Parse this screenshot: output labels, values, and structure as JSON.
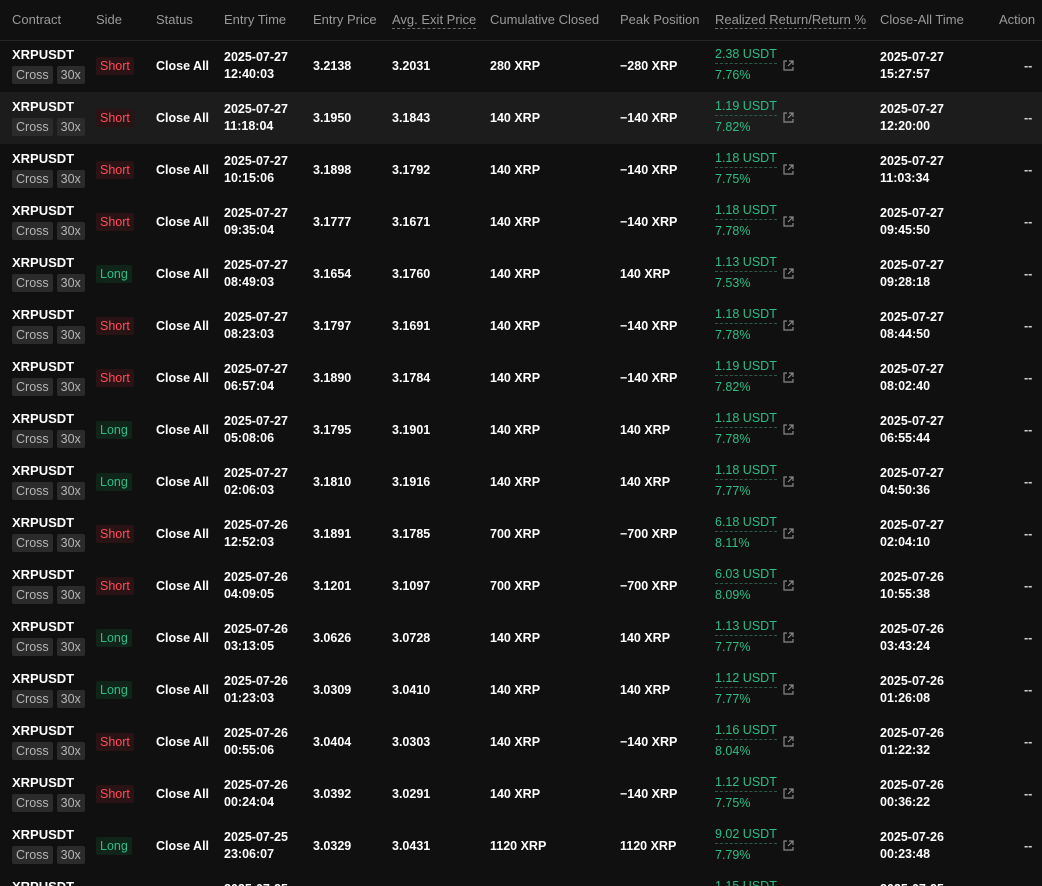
{
  "headers": {
    "contract": "Contract",
    "side": "Side",
    "status": "Status",
    "entry_time": "Entry Time",
    "entry_price": "Entry Price",
    "avg_exit_price": "Avg. Exit Price",
    "cumulative_closed": "Cumulative Closed",
    "peak_position": "Peak Position",
    "realized_return": "Realized Return/Return %",
    "close_all_time": "Close-All Time",
    "action": "Action"
  },
  "colors": {
    "short": "#ff4d5a",
    "long": "#2ebd85",
    "profit": "#2ebd85"
  },
  "icons": {
    "share": "external-link-icon"
  },
  "rows": [
    {
      "symbol": "XRPUSDT",
      "margin": "Cross",
      "leverage": "30x",
      "side": "Short",
      "status": "Close All",
      "entry_date": "2025-07-27",
      "entry_clock": "12:40:03",
      "entry_price": "3.2138",
      "exit_price": "3.2031",
      "cum": "280 XRP",
      "peak": "−280 XRP",
      "ret_amt": "2.38 USDT",
      "ret_pct": "7.76%",
      "close_date": "2025-07-27",
      "close_clock": "15:27:57",
      "action": "--"
    },
    {
      "symbol": "XRPUSDT",
      "margin": "Cross",
      "leverage": "30x",
      "side": "Short",
      "status": "Close All",
      "entry_date": "2025-07-27",
      "entry_clock": "11:18:04",
      "entry_price": "3.1950",
      "exit_price": "3.1843",
      "cum": "140 XRP",
      "peak": "−140 XRP",
      "ret_amt": "1.19 USDT",
      "ret_pct": "7.82%",
      "close_date": "2025-07-27",
      "close_clock": "12:20:00",
      "action": "--"
    },
    {
      "symbol": "XRPUSDT",
      "margin": "Cross",
      "leverage": "30x",
      "side": "Short",
      "status": "Close All",
      "entry_date": "2025-07-27",
      "entry_clock": "10:15:06",
      "entry_price": "3.1898",
      "exit_price": "3.1792",
      "cum": "140 XRP",
      "peak": "−140 XRP",
      "ret_amt": "1.18 USDT",
      "ret_pct": "7.75%",
      "close_date": "2025-07-27",
      "close_clock": "11:03:34",
      "action": "--"
    },
    {
      "symbol": "XRPUSDT",
      "margin": "Cross",
      "leverage": "30x",
      "side": "Short",
      "status": "Close All",
      "entry_date": "2025-07-27",
      "entry_clock": "09:35:04",
      "entry_price": "3.1777",
      "exit_price": "3.1671",
      "cum": "140 XRP",
      "peak": "−140 XRP",
      "ret_amt": "1.18 USDT",
      "ret_pct": "7.78%",
      "close_date": "2025-07-27",
      "close_clock": "09:45:50",
      "action": "--"
    },
    {
      "symbol": "XRPUSDT",
      "margin": "Cross",
      "leverage": "30x",
      "side": "Long",
      "status": "Close All",
      "entry_date": "2025-07-27",
      "entry_clock": "08:49:03",
      "entry_price": "3.1654",
      "exit_price": "3.1760",
      "cum": "140 XRP",
      "peak": "140 XRP",
      "ret_amt": "1.13 USDT",
      "ret_pct": "7.53%",
      "close_date": "2025-07-27",
      "close_clock": "09:28:18",
      "action": "--"
    },
    {
      "symbol": "XRPUSDT",
      "margin": "Cross",
      "leverage": "30x",
      "side": "Short",
      "status": "Close All",
      "entry_date": "2025-07-27",
      "entry_clock": "08:23:03",
      "entry_price": "3.1797",
      "exit_price": "3.1691",
      "cum": "140 XRP",
      "peak": "−140 XRP",
      "ret_amt": "1.18 USDT",
      "ret_pct": "7.78%",
      "close_date": "2025-07-27",
      "close_clock": "08:44:50",
      "action": "--"
    },
    {
      "symbol": "XRPUSDT",
      "margin": "Cross",
      "leverage": "30x",
      "side": "Short",
      "status": "Close All",
      "entry_date": "2025-07-27",
      "entry_clock": "06:57:04",
      "entry_price": "3.1890",
      "exit_price": "3.1784",
      "cum": "140 XRP",
      "peak": "−140 XRP",
      "ret_amt": "1.19 USDT",
      "ret_pct": "7.82%",
      "close_date": "2025-07-27",
      "close_clock": "08:02:40",
      "action": "--"
    },
    {
      "symbol": "XRPUSDT",
      "margin": "Cross",
      "leverage": "30x",
      "side": "Long",
      "status": "Close All",
      "entry_date": "2025-07-27",
      "entry_clock": "05:08:06",
      "entry_price": "3.1795",
      "exit_price": "3.1901",
      "cum": "140 XRP",
      "peak": "140 XRP",
      "ret_amt": "1.18 USDT",
      "ret_pct": "7.78%",
      "close_date": "2025-07-27",
      "close_clock": "06:55:44",
      "action": "--"
    },
    {
      "symbol": "XRPUSDT",
      "margin": "Cross",
      "leverage": "30x",
      "side": "Long",
      "status": "Close All",
      "entry_date": "2025-07-27",
      "entry_clock": "02:06:03",
      "entry_price": "3.1810",
      "exit_price": "3.1916",
      "cum": "140 XRP",
      "peak": "140 XRP",
      "ret_amt": "1.18 USDT",
      "ret_pct": "7.77%",
      "close_date": "2025-07-27",
      "close_clock": "04:50:36",
      "action": "--"
    },
    {
      "symbol": "XRPUSDT",
      "margin": "Cross",
      "leverage": "30x",
      "side": "Short",
      "status": "Close All",
      "entry_date": "2025-07-26",
      "entry_clock": "12:52:03",
      "entry_price": "3.1891",
      "exit_price": "3.1785",
      "cum": "700 XRP",
      "peak": "−700 XRP",
      "ret_amt": "6.18 USDT",
      "ret_pct": "8.11%",
      "close_date": "2025-07-27",
      "close_clock": "02:04:10",
      "action": "--"
    },
    {
      "symbol": "XRPUSDT",
      "margin": "Cross",
      "leverage": "30x",
      "side": "Short",
      "status": "Close All",
      "entry_date": "2025-07-26",
      "entry_clock": "04:09:05",
      "entry_price": "3.1201",
      "exit_price": "3.1097",
      "cum": "700 XRP",
      "peak": "−700 XRP",
      "ret_amt": "6.03 USDT",
      "ret_pct": "8.09%",
      "close_date": "2025-07-26",
      "close_clock": "10:55:38",
      "action": "--"
    },
    {
      "symbol": "XRPUSDT",
      "margin": "Cross",
      "leverage": "30x",
      "side": "Long",
      "status": "Close All",
      "entry_date": "2025-07-26",
      "entry_clock": "03:13:05",
      "entry_price": "3.0626",
      "exit_price": "3.0728",
      "cum": "140 XRP",
      "peak": "140 XRP",
      "ret_amt": "1.13 USDT",
      "ret_pct": "7.77%",
      "close_date": "2025-07-26",
      "close_clock": "03:43:24",
      "action": "--"
    },
    {
      "symbol": "XRPUSDT",
      "margin": "Cross",
      "leverage": "30x",
      "side": "Long",
      "status": "Close All",
      "entry_date": "2025-07-26",
      "entry_clock": "01:23:03",
      "entry_price": "3.0309",
      "exit_price": "3.0410",
      "cum": "140 XRP",
      "peak": "140 XRP",
      "ret_amt": "1.12 USDT",
      "ret_pct": "7.77%",
      "close_date": "2025-07-26",
      "close_clock": "01:26:08",
      "action": "--"
    },
    {
      "symbol": "XRPUSDT",
      "margin": "Cross",
      "leverage": "30x",
      "side": "Short",
      "status": "Close All",
      "entry_date": "2025-07-26",
      "entry_clock": "00:55:06",
      "entry_price": "3.0404",
      "exit_price": "3.0303",
      "cum": "140 XRP",
      "peak": "−140 XRP",
      "ret_amt": "1.16 USDT",
      "ret_pct": "8.04%",
      "close_date": "2025-07-26",
      "close_clock": "01:22:32",
      "action": "--"
    },
    {
      "symbol": "XRPUSDT",
      "margin": "Cross",
      "leverage": "30x",
      "side": "Short",
      "status": "Close All",
      "entry_date": "2025-07-26",
      "entry_clock": "00:24:04",
      "entry_price": "3.0392",
      "exit_price": "3.0291",
      "cum": "140 XRP",
      "peak": "−140 XRP",
      "ret_amt": "1.12 USDT",
      "ret_pct": "7.75%",
      "close_date": "2025-07-26",
      "close_clock": "00:36:22",
      "action": "--"
    },
    {
      "symbol": "XRPUSDT",
      "margin": "Cross",
      "leverage": "30x",
      "side": "Long",
      "status": "Close All",
      "entry_date": "2025-07-25",
      "entry_clock": "23:06:07",
      "entry_price": "3.0329",
      "exit_price": "3.0431",
      "cum": "1120 XRP",
      "peak": "1120 XRP",
      "ret_amt": "9.02 USDT",
      "ret_pct": "7.79%",
      "close_date": "2025-07-26",
      "close_clock": "00:23:48",
      "action": "--"
    },
    {
      "symbol": "XRPUSDT",
      "margin": "",
      "leverage": "",
      "side": "",
      "status": "",
      "entry_date": "2025-07-25",
      "entry_clock": "",
      "entry_price": "",
      "exit_price": "",
      "cum": "",
      "peak": "",
      "ret_amt": "1.15 USDT",
      "ret_pct": "",
      "close_date": "2025-07-25",
      "close_clock": "",
      "action": ""
    }
  ]
}
